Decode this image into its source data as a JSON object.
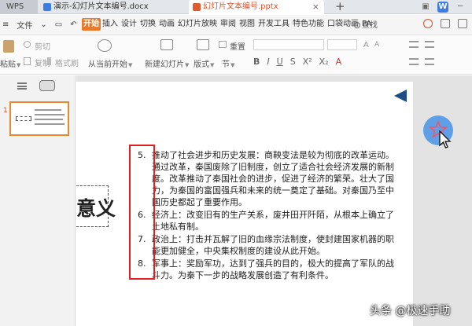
{
  "tabbar": {
    "app_label": "WPS",
    "tabs": [
      {
        "label": "演示-幻灯片文本编号.docx"
      },
      {
        "label": "幻灯片文本编号.pptx"
      }
    ],
    "add_label": "+"
  },
  "menu": {
    "file_label": "文件",
    "tabs": [
      "开始",
      "插入",
      "设计",
      "切换",
      "动画",
      "幻灯片放映",
      "审阅",
      "视图",
      "开发工具",
      "特色功能",
      "口袋动画",
      "PA"
    ],
    "active_tab": "开始",
    "search_label": "查找"
  },
  "ribbon": {
    "paste": "粘贴",
    "cut": "剪切",
    "copy": "复制",
    "format_painter": "格式刷",
    "from_current": "从当前开始",
    "new_slide": "新建幻灯片",
    "layout": "版式",
    "section": "节",
    "reset": "重置"
  },
  "slide": {
    "title_fragment": "意义",
    "items": [
      {
        "num": "5.",
        "text": "推动了社会进步和历史发展：商鞅变法是较为彻底的改革运动。通过改革，秦国废除了旧制度，创立了适合社会经济发展的新制度。改革推动了秦国社会的进步，促进了经济的繁荣。壮大了国力，为秦国的富国强兵和未来的统一奠定了基础。对秦国乃至中国历史都起了重要作用。"
      },
      {
        "num": "6.",
        "text": "经济上：改变旧有的生产关系，废井田开阡陌，从根本上确立了土地私有制。"
      },
      {
        "num": "7.",
        "text": "政治上：打击并瓦解了旧的血缘宗法制度，使封建国家机器的职能更加健全，中央集权制度的建设从此开始。"
      },
      {
        "num": "8.",
        "text": "军事上：奖励军功，达到了强兵的目的，极大的提高了军队的战斗力。为秦下一步的战略发展创造了有利条件。"
      }
    ]
  },
  "thumbnail": {
    "number": "1"
  },
  "watermark": "头条 @极速手助",
  "colors": {
    "accent": "#e87a2c",
    "highlight_box": "#e02020",
    "star_button": "#5ea0e8"
  }
}
